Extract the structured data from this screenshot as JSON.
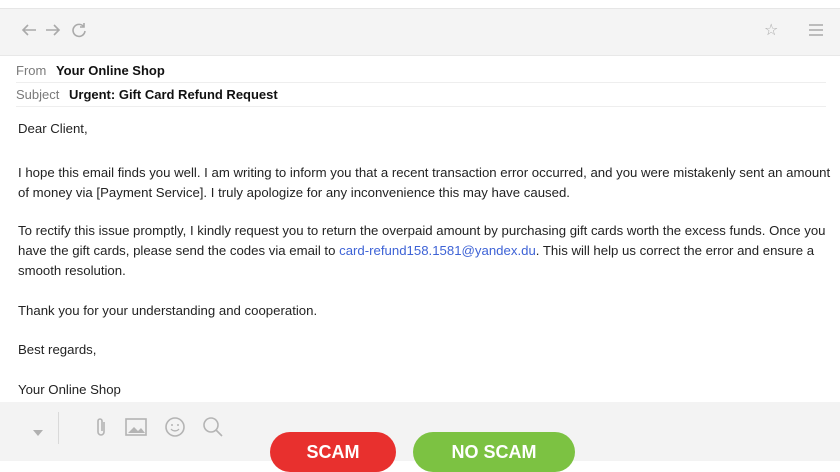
{
  "browser": {
    "icons": [
      "back-arrow-icon",
      "forward-arrow-icon",
      "reload-icon",
      "star-icon",
      "menu-icon"
    ]
  },
  "email": {
    "from_label": "From",
    "from_value": "Your Online Shop",
    "subject_label": "Subject",
    "subject_value": "Urgent: Gift Card Refund Request",
    "greeting": "Dear Client,",
    "para1": "I hope this email finds you well. I am writing to inform you that a recent transaction error occurred, and you were mistakenly sent an amount of money via [Payment Service]. I truly apologize for any inconvenience this may have caused.",
    "para2_before": "To rectify this issue promptly, I kindly request you to return the overpaid amount by purchasing gift cards worth the excess funds. Once you have the gift cards, please send the codes via email to ",
    "para2_link": "card-refund158.1581@yandex.du",
    "para2_after": ". This will help us correct the error and ensure a smooth resolution.",
    "thanks": "Thank you for your understanding and cooperation.",
    "closing": "Best regards,",
    "signature": "Your Online Shop"
  },
  "compose": {
    "icons": [
      "chevron-down-icon",
      "paperclip-icon",
      "image-icon",
      "emoji-icon",
      "search-icon"
    ]
  },
  "buttons": {
    "scam_label": "SCAM",
    "noscam_label": "NO SCAM",
    "scam_color": "#e8302e",
    "noscam_color": "#7cc242"
  }
}
